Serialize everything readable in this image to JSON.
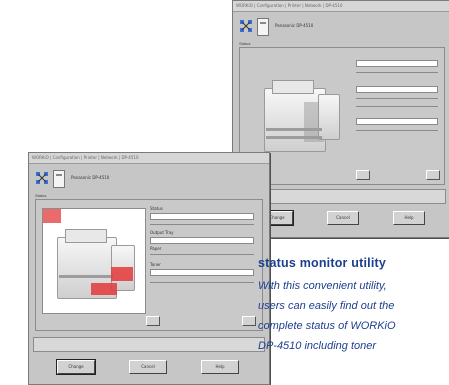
{
  "back_window": {
    "title": "WORKiO | Configuration | Printer | Network | DP-4510",
    "device_name": "Panasonic DP-4510",
    "status_label": "Status",
    "buttons": [
      "Change",
      "Cancel",
      "Help"
    ]
  },
  "front_window": {
    "title": "WORKiO | Configuration | Printer | Network | DP-4510",
    "device_name": "Panasonic DP-4510",
    "status_label": "Status",
    "info_labels": [
      "Status",
      "Output Tray",
      "Paper",
      "Toner"
    ],
    "buttons": [
      "Change",
      "Cancel",
      "Help"
    ]
  },
  "caption": {
    "title": "status monitor utility",
    "lines": [
      "With this convenient utility,",
      "users can easily find out the",
      "complete status of WORKiO",
      "DP-4510 including toner"
    ]
  },
  "colors": {
    "caption_blue": "#1d3f8f",
    "window_gray": "#c6c6c6",
    "alert_red": "#e33a3a"
  }
}
